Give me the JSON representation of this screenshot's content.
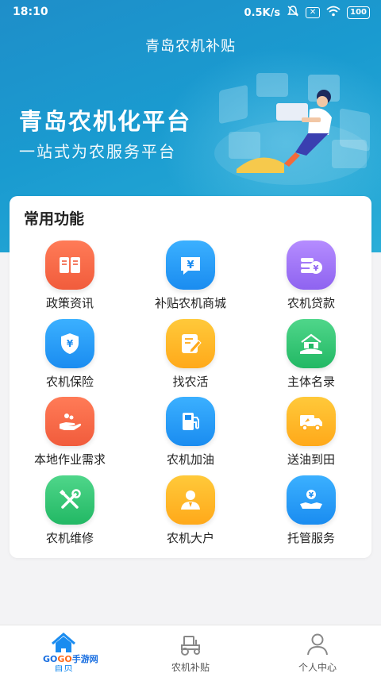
{
  "status_bar": {
    "time": "18:10",
    "network_speed": "0.5K/s",
    "battery": "100"
  },
  "header": {
    "title": "青岛农机补贴"
  },
  "banner": {
    "title": "青岛农机化平台",
    "subtitle": "一站式为农服务平台"
  },
  "functions": {
    "title": "常用功能",
    "items": [
      {
        "label": "政策资讯",
        "icon": "book-icon",
        "color": "#f4633f"
      },
      {
        "label": "补贴农机商城",
        "icon": "yuan-chat-icon",
        "color": "#2a9ef7"
      },
      {
        "label": "农机贷款",
        "icon": "coins-icon",
        "color": "#9d74f6"
      },
      {
        "label": "农机保险",
        "icon": "shield-yuan-icon",
        "color": "#2a9ef7"
      },
      {
        "label": "找农活",
        "icon": "notepad-icon",
        "color": "#ffb526"
      },
      {
        "label": "主体名录",
        "icon": "farmhouse-icon",
        "color": "#2fc474"
      },
      {
        "label": "本地作业需求",
        "icon": "hand-icon",
        "color": "#f4633f"
      },
      {
        "label": "农机加油",
        "icon": "fuel-pump-icon",
        "color": "#2a9ef7"
      },
      {
        "label": "送油到田",
        "icon": "truck-icon",
        "color": "#ffb526"
      },
      {
        "label": "农机维修",
        "icon": "wrench-screwdriver-icon",
        "color": "#2fc474"
      },
      {
        "label": "农机大户",
        "icon": "person-icon",
        "color": "#ffb526"
      },
      {
        "label": "托管服务",
        "icon": "hand-coin-icon",
        "color": "#2a9ef7"
      }
    ]
  },
  "bottom_nav": {
    "items": [
      {
        "label": "首页",
        "icon": "home-icon",
        "active": true
      },
      {
        "label": "农机补贴",
        "icon": "tractor-icon",
        "active": false
      },
      {
        "label": "个人中心",
        "icon": "user-icon",
        "active": false
      }
    ]
  },
  "watermark": {
    "text_a": "GO",
    "text_b": "GO",
    "text_c": "手游网"
  },
  "colors": {
    "primary": "#1a8cf0",
    "banner": "#1e8ec9"
  }
}
